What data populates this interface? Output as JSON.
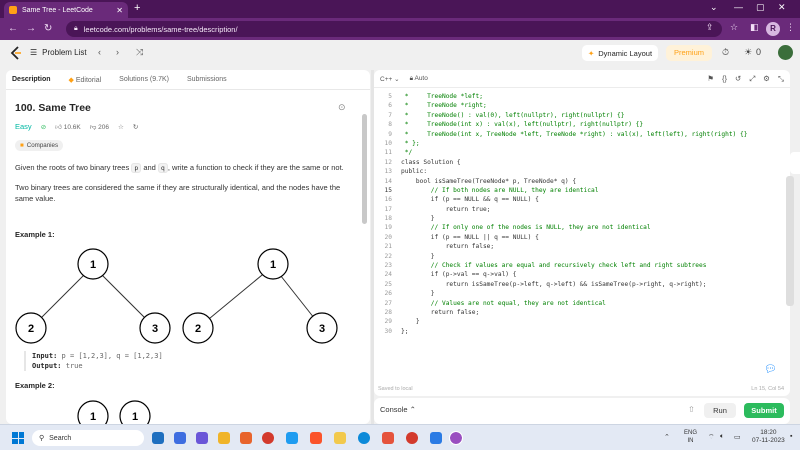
{
  "browser": {
    "tab_title": "Same Tree - LeetCode",
    "url": "leetcode.com/problems/same-tree/description/",
    "profile_initial": "R"
  },
  "nav": {
    "problem_list": "Problem List",
    "dynamic_layout": "Dynamic Layout",
    "premium": "Premium",
    "streak_count": "0"
  },
  "left": {
    "tabs": [
      "Description",
      "Editorial",
      "Solutions (9.7K)",
      "Submissions"
    ],
    "title": "100. Same Tree",
    "difficulty": "Easy",
    "likes": "10.6K",
    "dislikes": "206",
    "companies": "Companies",
    "desc1_a": "Given the roots of two binary trees ",
    "desc1_p": "p",
    "desc1_b": " and ",
    "desc1_q": "q",
    "desc1_c": ", write a function to check if they are the same or not.",
    "desc2": "Two binary trees are considered the same if they are structurally identical, and the nodes have the same value.",
    "example1_title": "Example 1:",
    "example1_input_label": "Input:",
    "example1_input": "p = [1,2,3], q = [1,2,3]",
    "example1_output_label": "Output:",
    "example1_output": "true",
    "example2_title": "Example 2:",
    "tree_nodes": {
      "root": "1",
      "left": "2",
      "right": "3"
    },
    "example2_nodes": [
      "1",
      "1"
    ]
  },
  "editor": {
    "language": "C++",
    "auto": "Auto",
    "saved": "Saved to local",
    "cursor_pos": "Ln 15, Col 54",
    "lines": [
      {
        "n": "5",
        "t": " *     TreeNode *left;",
        "k": "cm"
      },
      {
        "n": "6",
        "t": " *     TreeNode *right;",
        "k": "cm"
      },
      {
        "n": "7",
        "t": " *     TreeNode() : val(0), left(nullptr), right(nullptr) {}",
        "k": "cm"
      },
      {
        "n": "8",
        "t": " *     TreeNode(int x) : val(x), left(nullptr), right(nullptr) {}",
        "k": "cm"
      },
      {
        "n": "9",
        "t": " *     TreeNode(int x, TreeNode *left, TreeNode *right) : val(x), left(left), right(right) {}",
        "k": "cm"
      },
      {
        "n": "10",
        "t": " * };",
        "k": "cm"
      },
      {
        "n": "11",
        "t": " */",
        "k": "cm"
      },
      {
        "n": "12",
        "t": "class Solution {",
        "k": "tx"
      },
      {
        "n": "13",
        "t": "public:",
        "k": "tx"
      },
      {
        "n": "14",
        "t": "    bool isSameTree(TreeNode* p, TreeNode* q) {",
        "k": "tx"
      },
      {
        "n": "15",
        "t": "        // If both nodes are NULL, they are identical",
        "k": "cm"
      },
      {
        "n": "16",
        "t": "        if (p == NULL && q == NULL) {",
        "k": "tx"
      },
      {
        "n": "17",
        "t": "            return true;",
        "k": "tx"
      },
      {
        "n": "18",
        "t": "        }",
        "k": "tx"
      },
      {
        "n": "19",
        "t": "        // If only one of the nodes is NULL, they are not identical",
        "k": "cm"
      },
      {
        "n": "20",
        "t": "        if (p == NULL || q == NULL) {",
        "k": "tx"
      },
      {
        "n": "21",
        "t": "            return false;",
        "k": "tx"
      },
      {
        "n": "22",
        "t": "        }",
        "k": "tx"
      },
      {
        "n": "23",
        "t": "        // Check if values are equal and recursively check left and right subtrees",
        "k": "cm"
      },
      {
        "n": "24",
        "t": "        if (p->val == q->val) {",
        "k": "tx"
      },
      {
        "n": "25",
        "t": "            return isSameTree(p->left, q->left) && isSameTree(p->right, q->right);",
        "k": "tx"
      },
      {
        "n": "26",
        "t": "        }",
        "k": "tx"
      },
      {
        "n": "27",
        "t": "        // Values are not equal, they are not identical",
        "k": "cm"
      },
      {
        "n": "28",
        "t": "        return false;",
        "k": "tx"
      },
      {
        "n": "29",
        "t": "    }",
        "k": "tx"
      },
      {
        "n": "30",
        "t": "};",
        "k": "tx"
      }
    ]
  },
  "console": {
    "label": "Console",
    "run": "Run",
    "submit": "Submit"
  },
  "taskbar": {
    "search": "Search",
    "lang1": "ENG",
    "lang2": "IN",
    "time": "18:20",
    "date": "07-11-2023"
  },
  "colors": {
    "accent_orange": "#ffa116",
    "easy_green": "#00b8a3",
    "submit_green": "#2cbb5d",
    "browser_purple": "#6a2a7a"
  }
}
